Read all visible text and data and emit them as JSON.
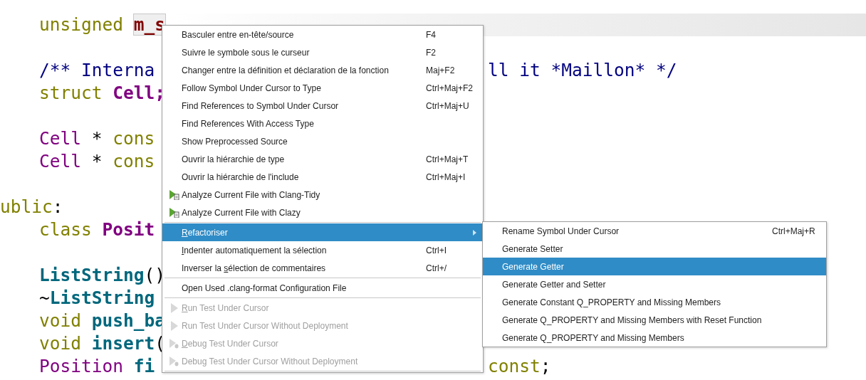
{
  "editor": {
    "lines": [
      {
        "current": false
      },
      {
        "indented": true,
        "current": true,
        "left": [
          {
            "text": "unsigned ",
            "kind": "keyword"
          },
          {
            "text": "m_s",
            "kind": "member"
          }
        ]
      },
      {
        "current": false
      },
      {
        "indented": true,
        "current": false,
        "left": [
          {
            "text": "/** Interna",
            "kind": "comment"
          }
        ],
        "right": [
          {
            "text": "ll it *Maillon* */",
            "kind": "comment"
          }
        ]
      },
      {
        "indented": true,
        "current": false,
        "left": [
          {
            "text": "struct ",
            "kind": "keyword"
          },
          {
            "text": "Cell;",
            "kind": "type_bold"
          }
        ]
      },
      {
        "current": false
      },
      {
        "indented": true,
        "current": false,
        "left": [
          {
            "text": "Cell",
            "kind": "type"
          },
          {
            "text": " * ",
            "kind": "plain"
          },
          {
            "text": "cons",
            "kind": "keyword"
          }
        ]
      },
      {
        "indented": true,
        "current": false,
        "left": [
          {
            "text": "Cell",
            "kind": "type"
          },
          {
            "text": " * ",
            "kind": "plain"
          },
          {
            "text": "cons",
            "kind": "keyword"
          }
        ]
      },
      {
        "current": false
      },
      {
        "indented": false,
        "current": false,
        "left": [
          {
            "text": "ublic",
            "kind": "keyword"
          },
          {
            "text": ":",
            "kind": "plain"
          }
        ]
      },
      {
        "indented": true,
        "current": false,
        "left": [
          {
            "text": "class ",
            "kind": "keyword"
          },
          {
            "text": "Posit",
            "kind": "type_bold"
          }
        ]
      },
      {
        "current": false
      },
      {
        "indented": true,
        "current": false,
        "left": [
          {
            "text": "ListString",
            "kind": "function"
          },
          {
            "text": "()",
            "kind": "plain"
          }
        ]
      },
      {
        "indented": true,
        "current": false,
        "left": [
          {
            "text": "~",
            "kind": "plain"
          },
          {
            "text": "ListString",
            "kind": "function"
          }
        ]
      },
      {
        "indented": true,
        "current": false,
        "left": [
          {
            "text": "void ",
            "kind": "keyword"
          },
          {
            "text": "push_ba",
            "kind": "function"
          }
        ]
      },
      {
        "indented": true,
        "current": false,
        "left": [
          {
            "text": "void ",
            "kind": "keyword"
          },
          {
            "text": "insert",
            "kind": "function"
          },
          {
            "text": "(",
            "kind": "plain"
          }
        ]
      },
      {
        "indented": true,
        "current": false,
        "left": [
          {
            "text": "Position ",
            "kind": "type"
          },
          {
            "text": "fi",
            "kind": "function"
          }
        ],
        "right": [
          {
            "text": "const",
            "kind": "keyword"
          },
          {
            "text": ";",
            "kind": "plain"
          }
        ]
      }
    ]
  },
  "context_menu": {
    "items": [
      {
        "kind": "item",
        "label": "Basculer entre en-tête/source",
        "shortcut": "F4",
        "disabled": false,
        "selected": false
      },
      {
        "kind": "item",
        "label": "Suivre le symbole sous le curseur",
        "shortcut": "F2",
        "disabled": false,
        "selected": false
      },
      {
        "kind": "item",
        "label": "Changer entre la définition et déclaration de la fonction",
        "shortcut": "Maj+F2",
        "disabled": false,
        "selected": false
      },
      {
        "kind": "item",
        "label": "Follow Symbol Under Cursor to Type",
        "shortcut": "Ctrl+Maj+F2",
        "disabled": false,
        "selected": false
      },
      {
        "kind": "item",
        "label": "Find References to Symbol Under Cursor",
        "shortcut": "Ctrl+Maj+U",
        "disabled": false,
        "selected": false
      },
      {
        "kind": "item",
        "label": "Find References With Access Type",
        "disabled": false,
        "selected": false
      },
      {
        "kind": "item",
        "label": "Show Preprocessed Source",
        "disabled": false,
        "selected": false
      },
      {
        "kind": "item",
        "label": "Ouvrir la hiérarchie de type",
        "shortcut": "Ctrl+Maj+T",
        "disabled": false,
        "selected": false
      },
      {
        "kind": "item",
        "label": "Ouvrir la hiérarchie de l'include",
        "shortcut": "Ctrl+Maj+I",
        "disabled": false,
        "selected": false
      },
      {
        "kind": "analyze",
        "label": "Analyze Current File with Clang-Tidy",
        "disabled": false,
        "selected": false
      },
      {
        "kind": "analyze",
        "label": "Analyze Current File with Clazy",
        "disabled": false,
        "selected": false
      },
      {
        "kind": "separator"
      },
      {
        "kind": "item",
        "label": "Refactoriser",
        "submenu": true,
        "disabled": false,
        "selected": true
      },
      {
        "kind": "item",
        "label": "Indenter automatiquement la sélection",
        "shortcut": "Ctrl+I",
        "disabled": false,
        "selected": false
      },
      {
        "kind": "item",
        "label": "Inverser la sélection de commentaires",
        "shortcut": "Ctrl+/",
        "disabled": false,
        "selected": false
      },
      {
        "kind": "separator"
      },
      {
        "kind": "item",
        "label": "Open Used .clang-format Configuration File",
        "disabled": false,
        "selected": false
      },
      {
        "kind": "separator"
      },
      {
        "kind": "test_run",
        "label": "Run Test Under Cursor",
        "disabled": true,
        "selected": false
      },
      {
        "kind": "test_run",
        "label": "Run Test Under Cursor Without Deployment",
        "disabled": true,
        "selected": false
      },
      {
        "kind": "test_debug",
        "label": "Debug Test Under Cursor",
        "disabled": true,
        "selected": false
      },
      {
        "kind": "test_debug",
        "label": "Debug Test Under Cursor Without Deployment",
        "disabled": true,
        "selected": false
      },
      {
        "kind": "separator"
      }
    ]
  },
  "submenu": {
    "items": [
      {
        "label": "Rename Symbol Under Cursor",
        "shortcut": "Ctrl+Maj+R",
        "selected": false
      },
      {
        "label": "Generate Setter",
        "selected": false
      },
      {
        "label": "Generate Getter",
        "selected": true
      },
      {
        "label": "Generate Getter and Setter",
        "selected": false
      },
      {
        "label": "Generate Constant Q_PROPERTY and Missing Members",
        "selected": false
      },
      {
        "label": "Generate Q_PROPERTY and Missing Members with Reset Function",
        "selected": false
      },
      {
        "label": "Generate Q_PROPERTY and Missing Members",
        "selected": false
      }
    ]
  }
}
